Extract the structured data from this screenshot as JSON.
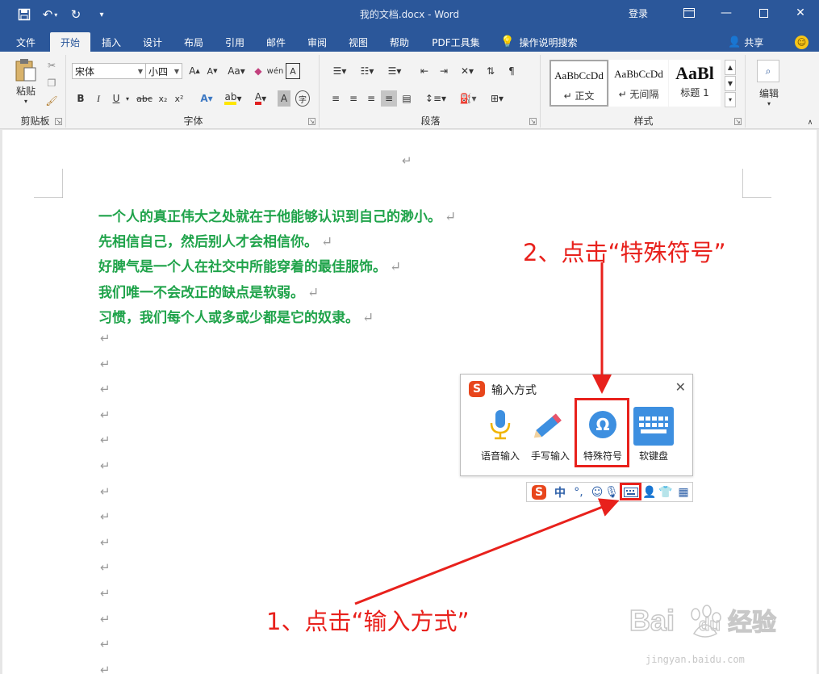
{
  "window": {
    "title": "我的文档.docx  -  Word",
    "login": "登录"
  },
  "tabs": [
    {
      "label": "文件"
    },
    {
      "label": "开始"
    },
    {
      "label": "插入"
    },
    {
      "label": "设计"
    },
    {
      "label": "布局"
    },
    {
      "label": "引用"
    },
    {
      "label": "邮件"
    },
    {
      "label": "审阅"
    },
    {
      "label": "视图"
    },
    {
      "label": "帮助"
    },
    {
      "label": "PDF工具集"
    }
  ],
  "tell_me": "操作说明搜索",
  "share": "共享",
  "ribbon": {
    "clipboard": {
      "paste": "粘贴",
      "label": "剪贴板"
    },
    "font": {
      "label": "字体",
      "font_name": "宋体",
      "font_size": "小四",
      "bold": "B",
      "italic": "I",
      "underline": "U",
      "strike": "abc",
      "sub": "x₂",
      "sup": "x²"
    },
    "paragraph": {
      "label": "段落"
    },
    "styles": {
      "label": "样式",
      "items": [
        {
          "sample": "AaBbCcDd",
          "name": "↵ 正文"
        },
        {
          "sample": "AaBbCcDd",
          "name": "↵ 无间隔"
        },
        {
          "sample": "AaBl",
          "name": "标题 1"
        }
      ]
    },
    "editing": {
      "label": "编辑"
    }
  },
  "document": {
    "lines": [
      "一个人的真正伟大之处就在于他能够认识到自己的渺小。",
      "先相信自己，然后别人才会相信你。",
      "好脾气是一个人在社交中所能穿着的最佳服饰。",
      "我们唯一不会改正的缺点是软弱。",
      "习惯，我们每个人或多或少都是它的奴隶。"
    ],
    "para_mark": "↵"
  },
  "ime_popup": {
    "title": "输入方式",
    "tools": [
      {
        "label": "语音输入"
      },
      {
        "label": "手写输入"
      },
      {
        "label": "特殊符号"
      },
      {
        "label": "软键盘"
      }
    ]
  },
  "ime_bar": {
    "logo": "S",
    "chinese": "中",
    "punct": "°,"
  },
  "annotations": {
    "step1": "1、点击“输入方式”",
    "step2": "2、点击“特殊符号”"
  },
  "watermark": {
    "brand_a": "Bai",
    "brand_b": "du",
    "brand_c": "经验",
    "url": "jingyan.baidu.com"
  },
  "colors": {
    "word_blue": "#2b579a",
    "text_green": "#1fa34a",
    "annotation_red": "#e8211c",
    "sogou_orange": "#e8461c"
  }
}
